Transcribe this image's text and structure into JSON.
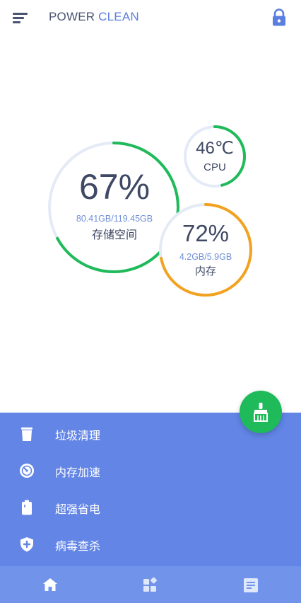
{
  "header": {
    "title_part1": "POWER ",
    "title_part2": "CLEAN",
    "menu_icon": "menu-icon",
    "lock_icon": "lock-icon"
  },
  "storage": {
    "percent_text": "67%",
    "usage_text": "80.41GB/119.45GB",
    "label": "存储空间",
    "level": 0.67,
    "color": "#1fba5a"
  },
  "cpu": {
    "temp_text": "46℃",
    "label": "CPU",
    "level": 0.46,
    "color": "#1fba5a"
  },
  "memory": {
    "percent_text": "72%",
    "usage_text": "4.2GB/5.9GB",
    "label": "内存",
    "level": 0.72,
    "color": "#f2a21f"
  },
  "fab": {
    "icon": "broom-icon",
    "color": "#1fba5a"
  },
  "menu": [
    {
      "label": "垃圾清理",
      "icon": "trash-icon"
    },
    {
      "label": "内存加速",
      "icon": "speedometer-icon"
    },
    {
      "label": "超强省电",
      "icon": "battery-icon"
    },
    {
      "label": "病毒查杀",
      "icon": "shield-plus-icon"
    }
  ],
  "nav": [
    {
      "icon": "home-icon"
    },
    {
      "icon": "apps-icon"
    },
    {
      "icon": "news-icon"
    }
  ],
  "colors": {
    "panel": "#6285e6",
    "nav": "#7293ea",
    "track": "#e4ebf7",
    "accent": "#5a7fe0"
  }
}
